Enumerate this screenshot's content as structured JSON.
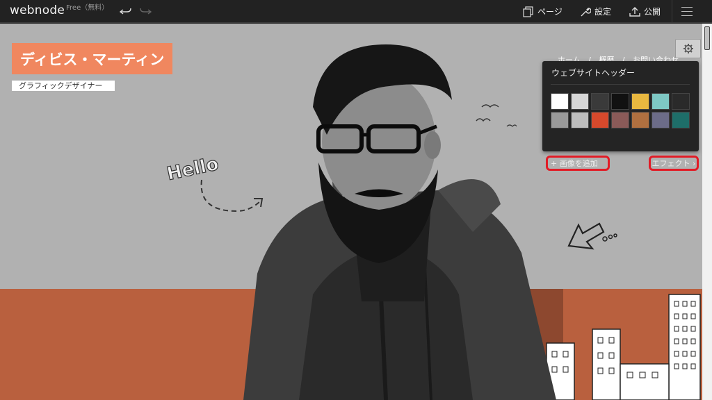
{
  "topbar": {
    "logo": "webnode",
    "plan": "Free（無料）",
    "pages_label": "ページ",
    "settings_label": "設定",
    "publish_label": "公開"
  },
  "site": {
    "name": "ディビス・マーティン",
    "subtitle": "グラフィックデザイナー",
    "nav": [
      "ホーム",
      "/",
      "概歴",
      "/",
      "お問い合わせ"
    ],
    "hello_text": "Hello"
  },
  "header_panel": {
    "title": "ウェブサイトヘッダー",
    "add_image_label": "+ 画像を追加",
    "effect_label": "エフェクト ›",
    "thumbnails": [
      {
        "name": "thumb-white",
        "color": "#ffffff"
      },
      {
        "name": "thumb-light-gray",
        "color": "#d6d6d6"
      },
      {
        "name": "thumb-dark-gray",
        "color": "#3a3a3a"
      },
      {
        "name": "thumb-black",
        "color": "#111111"
      },
      {
        "name": "thumb-yellow-pattern",
        "color": "#e9b840"
      },
      {
        "name": "thumb-teal-pattern",
        "color": "#7ec8c4"
      },
      {
        "name": "thumb-dark-grid",
        "color": "#2a2a2a"
      },
      {
        "name": "thumb-man-photo",
        "color": "#9a9a9a"
      },
      {
        "name": "thumb-sketch-photo",
        "color": "#bdbdbd"
      },
      {
        "name": "thumb-food-photo",
        "color": "#d6492c"
      },
      {
        "name": "thumb-abstract-photo",
        "color": "#8a5a58"
      },
      {
        "name": "thumb-tools-photo",
        "color": "#b07040"
      },
      {
        "name": "thumb-bike-photo",
        "color": "#6c6c88"
      },
      {
        "name": "thumb-teal-photo",
        "color": "#1e6e69"
      }
    ]
  },
  "colors": {
    "accent_orange": "#f0875f",
    "band_orange": "#b9603e",
    "highlight_red": "#e21b26"
  }
}
